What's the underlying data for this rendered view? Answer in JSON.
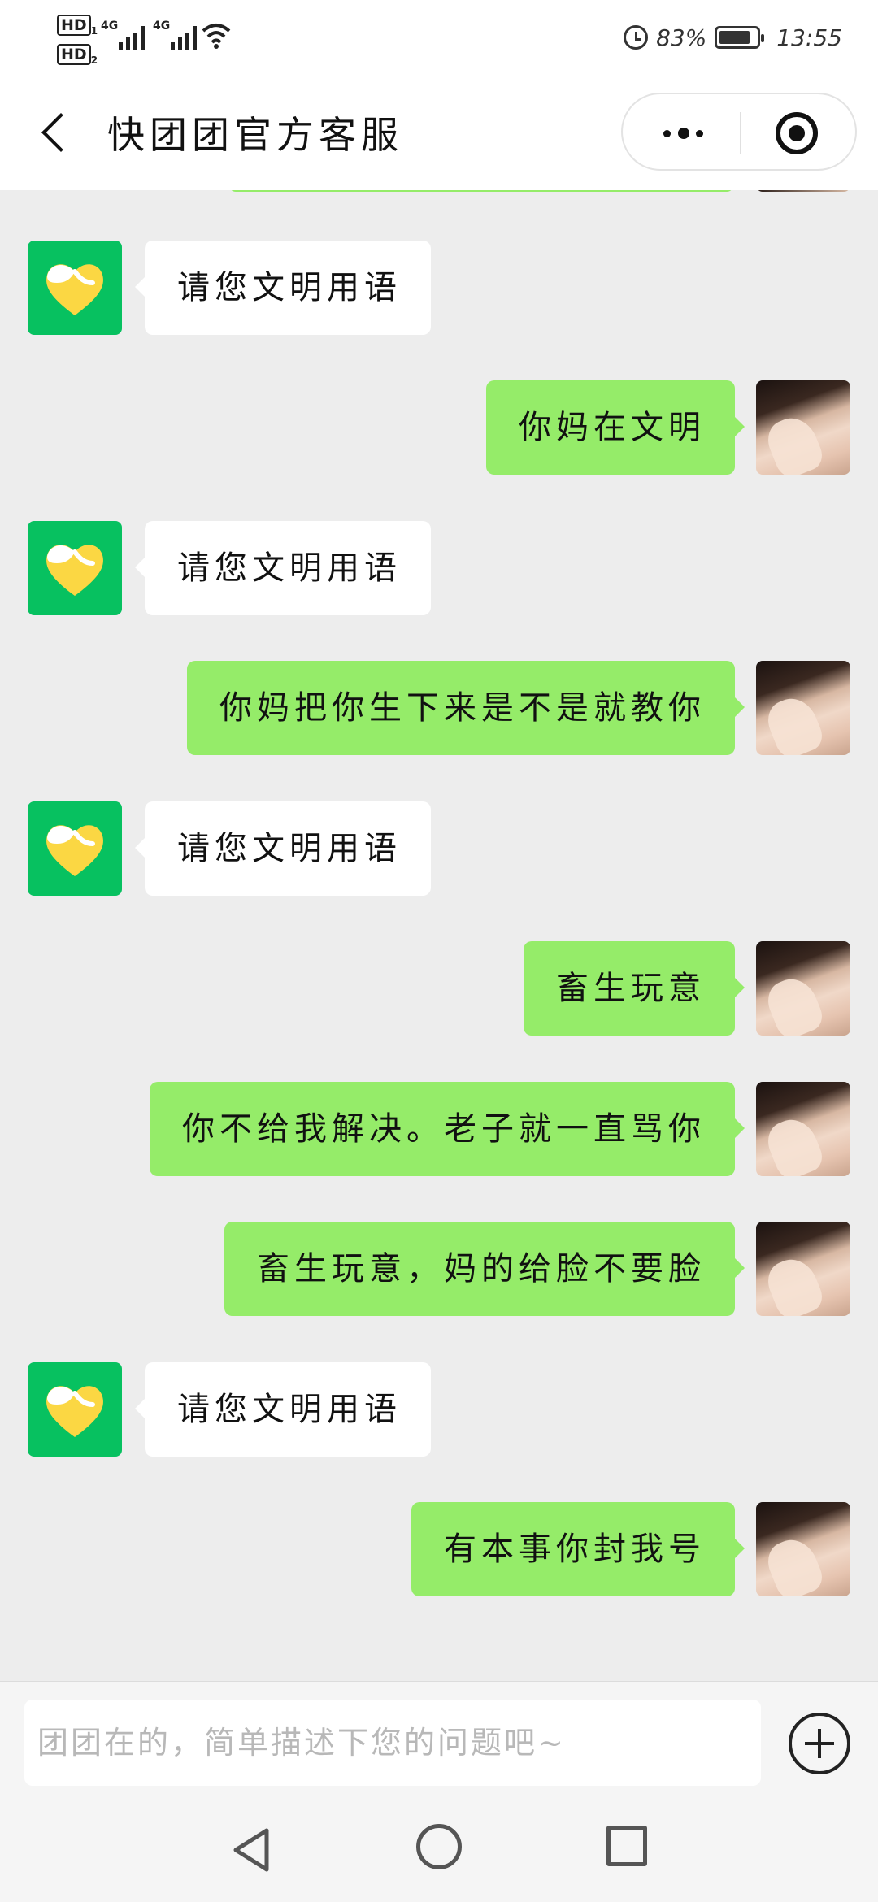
{
  "status_bar": {
    "hd_top": "HD",
    "hd_top_sub": "1",
    "hd_bottom": "HD",
    "hd_bottom_sub": "2",
    "signal_1_type": "4G",
    "signal_2_type": "4G",
    "battery_percent": "83%",
    "battery_level": 0.83,
    "time": "13:55"
  },
  "header": {
    "title": "快团团官方客服"
  },
  "messages": [
    {
      "side": "in",
      "text": "请您文明用语"
    },
    {
      "side": "out",
      "text": "你妈在文明"
    },
    {
      "side": "in",
      "text": "请您文明用语"
    },
    {
      "side": "out",
      "text": "你妈把你生下来是不是就教你"
    },
    {
      "side": "in",
      "text": "请您文明用语"
    },
    {
      "side": "out",
      "text": "畜生玩意"
    },
    {
      "side": "out",
      "text": "你不给我解决。老子就一直骂你"
    },
    {
      "side": "out",
      "text": "畜生玩意，妈的给脸不要脸"
    },
    {
      "side": "in",
      "text": "请您文明用语"
    },
    {
      "side": "out",
      "text": "有本事你封我号"
    }
  ],
  "input": {
    "placeholder": "团团在的，简单描述下您的问题吧~"
  },
  "colors": {
    "outgoing_bubble": "#95ec69",
    "incoming_bubble": "#ffffff",
    "bot_avatar_bg": "#07c160",
    "bot_heart": "#fbd743",
    "chat_bg": "#ededed"
  }
}
